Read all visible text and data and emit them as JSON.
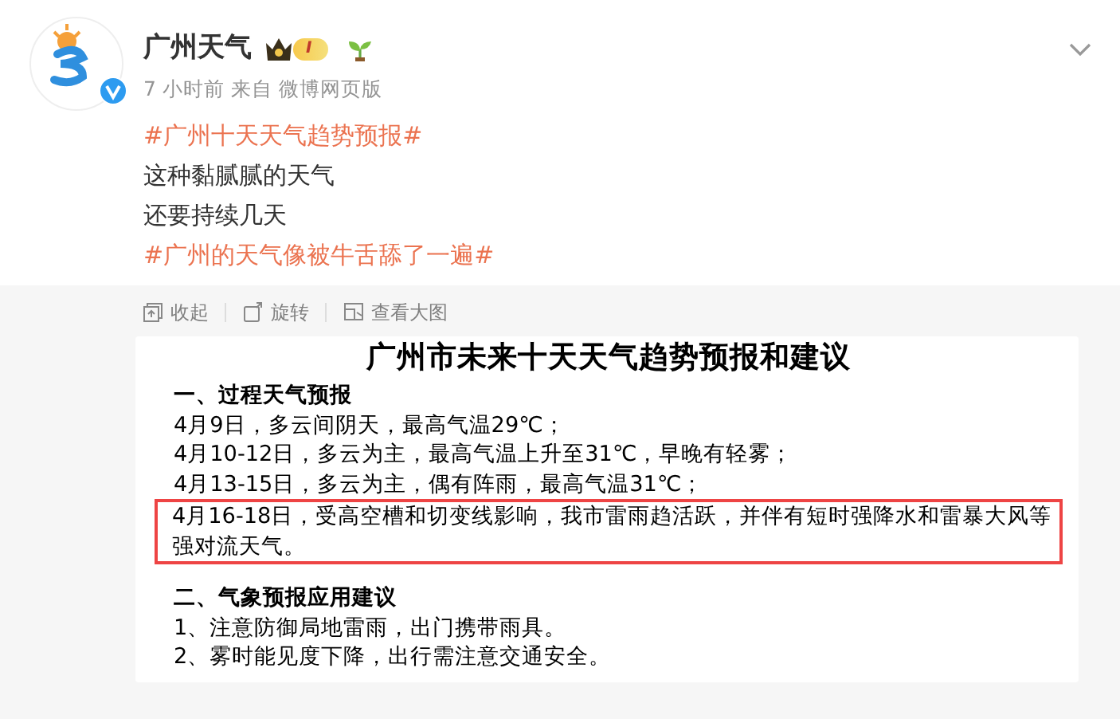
{
  "account": {
    "name": "广州天气",
    "verified": true,
    "level_badge": "I"
  },
  "meta": "7 小时前 来自 微博网页版",
  "post_lines": [
    {
      "kind": "hashtag",
      "text": "#广州十天天气趋势预报#"
    },
    {
      "kind": "plain",
      "text": "这种黏腻腻的天气"
    },
    {
      "kind": "plain",
      "text": "还要持续几天"
    },
    {
      "kind": "hashtag",
      "text": "#广州的天气像被牛舌舔了一遍#"
    }
  ],
  "image_toolbar": [
    {
      "kind": "collapse",
      "label": "收起"
    },
    {
      "kind": "rotate",
      "label": "旋转"
    },
    {
      "kind": "view",
      "label": "查看大图"
    }
  ],
  "image": {
    "title": "广州市未来十天天气趋势预报和建议",
    "sections": [
      {
        "heading": "一、过程天气预报",
        "lines": [
          {
            "text": "4月9日，多云间阴天，最高气温29℃；",
            "highlighted": false
          },
          {
            "text": "4月10-12日，多云为主，最高气温上升至31℃，早晚有轻雾；",
            "highlighted": false
          },
          {
            "text": "4月13-15日，多云为主，偶有阵雨，最高气温31℃；",
            "highlighted": false
          },
          {
            "text": "4月16-18日，受高空槽和切变线影响，我市雷雨趋活跃，并伴有短时强降水和雷暴大风等强对流天气。",
            "highlighted": true
          }
        ]
      },
      {
        "heading": "二、气象预报应用建议",
        "lines": [
          {
            "text": "1、注意防御局地雷雨，出门携带雨具。",
            "highlighted": false
          },
          {
            "text": "2、雾时能见度下降，出行需注意交通安全。",
            "highlighted": false
          }
        ]
      }
    ]
  }
}
